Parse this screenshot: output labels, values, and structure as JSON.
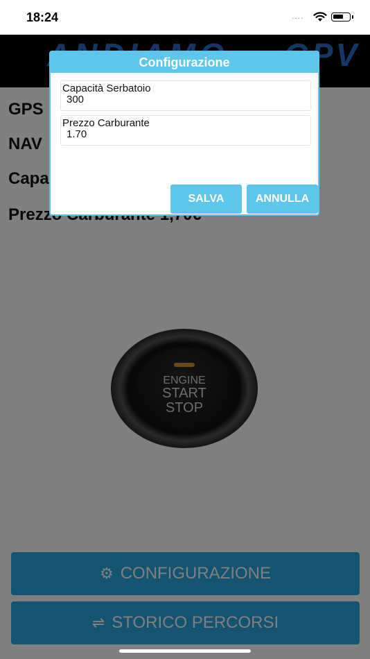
{
  "status_bar": {
    "time": "18:24",
    "signal": "····"
  },
  "header": {
    "logo_text": "ANDIAMO",
    "logo_text_end": "GPV"
  },
  "info": [
    {
      "label": "GPS"
    },
    {
      "label": "NAV"
    },
    {
      "label": "Capa"
    },
    {
      "label": "Prezzo Carburante 1,70€"
    }
  ],
  "engine_button": {
    "line1": "ENGINE",
    "line2": "START",
    "line3": "STOP"
  },
  "buttons": {
    "config_label": "CONFIGURAZIONE",
    "history_label": "STORICO PERCORSI"
  },
  "dialog": {
    "title": "Configurazione",
    "fields": [
      {
        "label": "Capacità Serbatoio",
        "value": "300"
      },
      {
        "label": "Prezzo Carburante",
        "value": "1.70"
      }
    ],
    "save_label": "SALVA",
    "cancel_label": "ANNULLA"
  },
  "colors": {
    "accent": "#5ec6ea",
    "button": "#2aa9e0",
    "logo": "#2a6fd0"
  }
}
